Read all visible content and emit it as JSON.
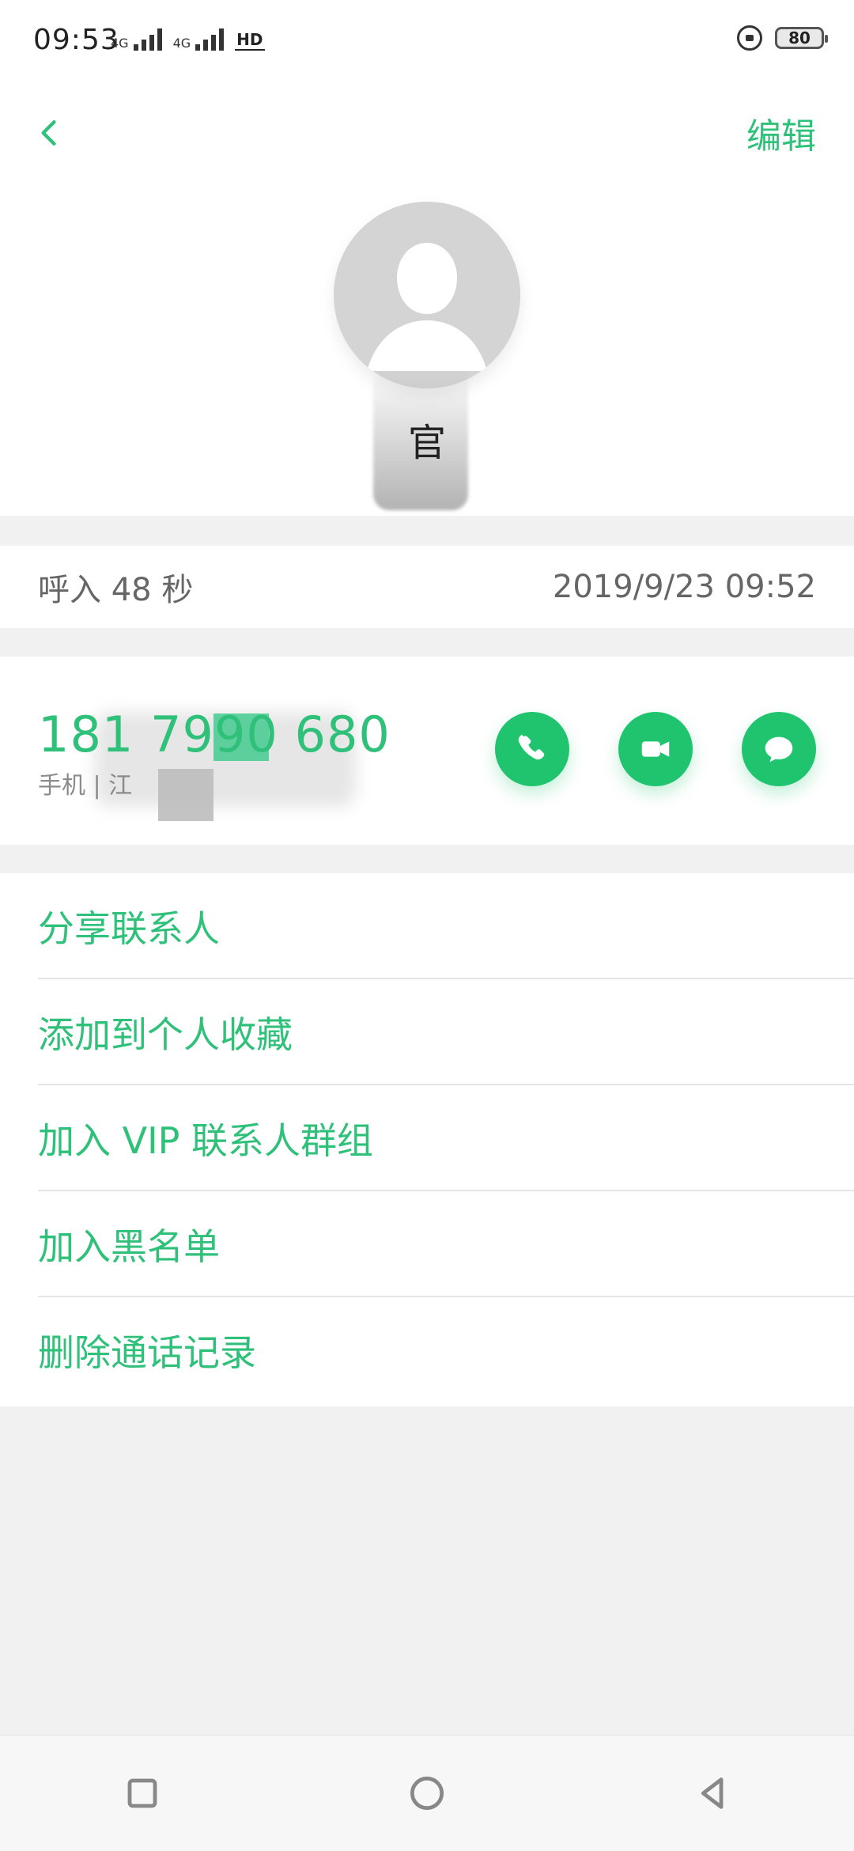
{
  "status_bar": {
    "time": "09:53",
    "signal_1_label": "4G",
    "signal_2_label": "4G",
    "hd_label": "HD",
    "battery_level": "80"
  },
  "topbar": {
    "edit_label": "编辑"
  },
  "contact": {
    "name_visible_char": "官"
  },
  "call_log": {
    "type_duration": "呼入  48 秒",
    "timestamp": "2019/9/23 09:52"
  },
  "phone": {
    "number": "181 7990  680",
    "meta": "手机 | 江"
  },
  "menu": {
    "items": [
      {
        "label": "分享联系人"
      },
      {
        "label": "添加到个人收藏"
      },
      {
        "label": "加入 VIP 联系人群组"
      },
      {
        "label": "加入黑名单"
      },
      {
        "label": "删除通话记录"
      }
    ]
  },
  "colors": {
    "accent": "#2fc07a",
    "action_button": "#20c46f"
  },
  "icons": {
    "back": "chevron-left-icon",
    "call": "phone-icon",
    "video": "video-camera-icon",
    "message": "message-bubble-icon",
    "nav_recent": "square-icon",
    "nav_home": "circle-icon",
    "nav_back": "triangle-left-icon"
  }
}
